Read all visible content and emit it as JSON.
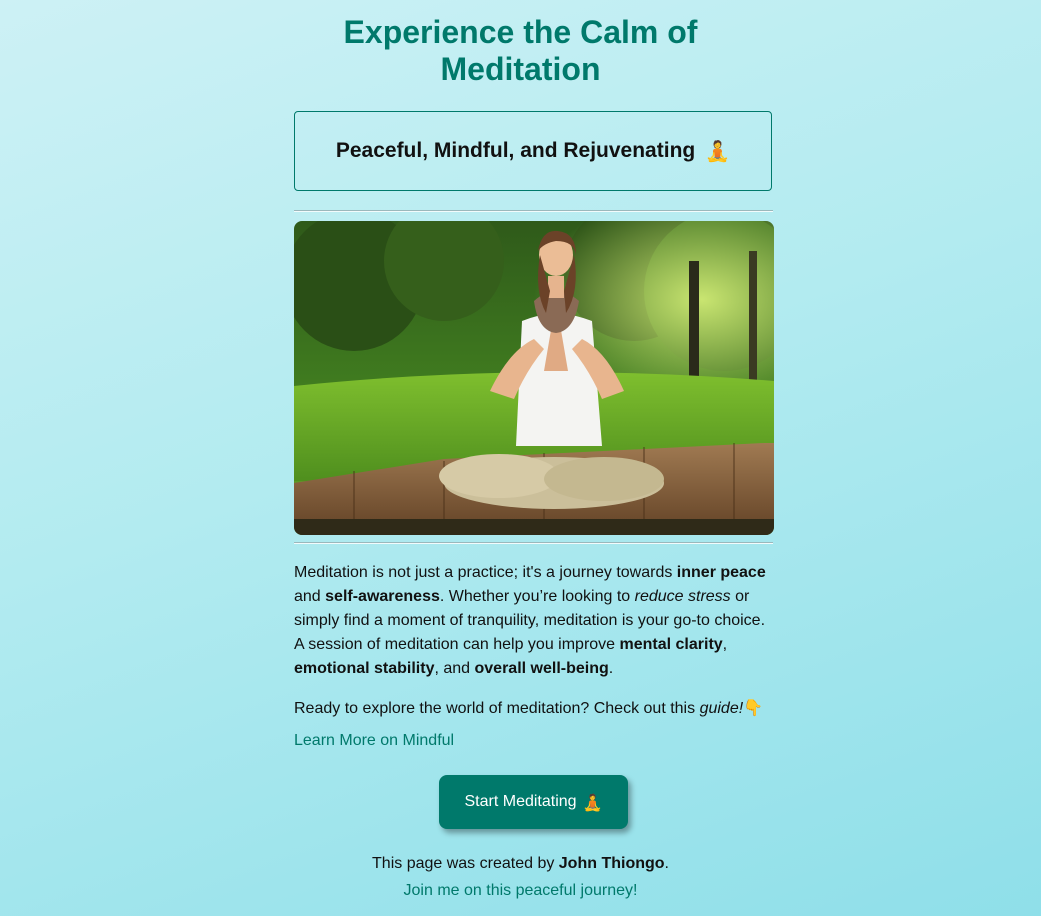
{
  "header": {
    "title_line1": "Experience the Calm of",
    "title_line2": "Meditation",
    "subtitle": "Peaceful, Mindful, and Rejuvenating",
    "subtitle_emoji": "🧘"
  },
  "hero_image": {
    "icon": "meditating-woman-photo"
  },
  "intro": {
    "t1": "Meditation is not just a practice; it's a journey towards ",
    "b1": "inner peace",
    "t2": " and ",
    "b2": "self-awareness",
    "t3": ". Whether you’re looking to ",
    "i1": "reduce stress",
    "t4": " or simply find a moment of tranquility, meditation is your go-to choice. A session of meditation can help you improve ",
    "b3": "mental clarity",
    "t5": ", ",
    "b4": "emotional stability",
    "t6": ", and ",
    "b5": "overall well-being",
    "t7": "."
  },
  "cta_text": {
    "text": "Ready to explore the world of meditation? Check out this ",
    "italic": "guide!",
    "emoji": "👇"
  },
  "link": {
    "label": "Learn More on Mindful"
  },
  "button": {
    "label": "Start Meditating",
    "emoji": "🧘"
  },
  "footer": {
    "credit_prefix": "This page was created by ",
    "author": "John Thiongo",
    "credit_suffix": ".",
    "join_link": "Join me on this peaceful journey!"
  },
  "colors": {
    "accent": "#00796b",
    "background_start": "#cdf1f5",
    "background_end": "#8fdfe9"
  }
}
